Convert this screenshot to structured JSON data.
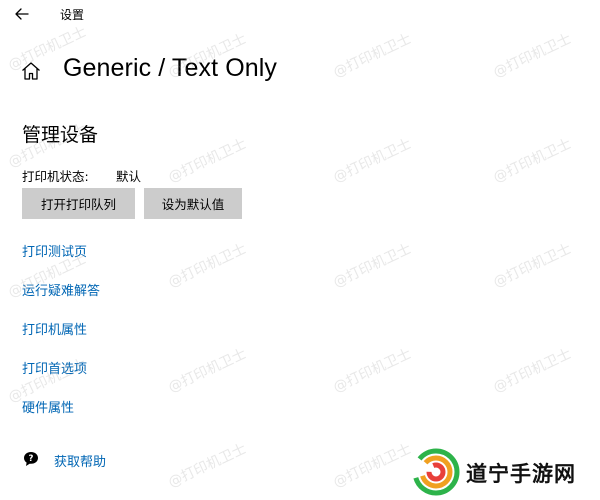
{
  "window": {
    "app_title": "设置",
    "back_icon": "back-arrow-icon"
  },
  "header": {
    "icon": "home-icon",
    "title": "Generic / Text Only"
  },
  "section": {
    "title": "管理设备"
  },
  "status": {
    "label": "打印机状态:",
    "value": "默认"
  },
  "buttons": {
    "open_queue": "打开打印队列",
    "set_default": "设为默认值"
  },
  "links": [
    {
      "label": "打印测试页"
    },
    {
      "label": "运行疑难解答"
    },
    {
      "label": "打印机属性"
    },
    {
      "label": "打印首选项"
    },
    {
      "label": "硬件属性"
    }
  ],
  "help": {
    "icon": "help-chat-icon",
    "label": "获取帮助"
  },
  "watermark": {
    "text": "@打印机卫士"
  },
  "brand": {
    "logo_icon": "swirl-logo-icon",
    "name": "道宁手游网"
  },
  "colors": {
    "background": "#ffffff",
    "link": "#0066b4",
    "button_bg": "#cccccc",
    "text": "#000000"
  }
}
